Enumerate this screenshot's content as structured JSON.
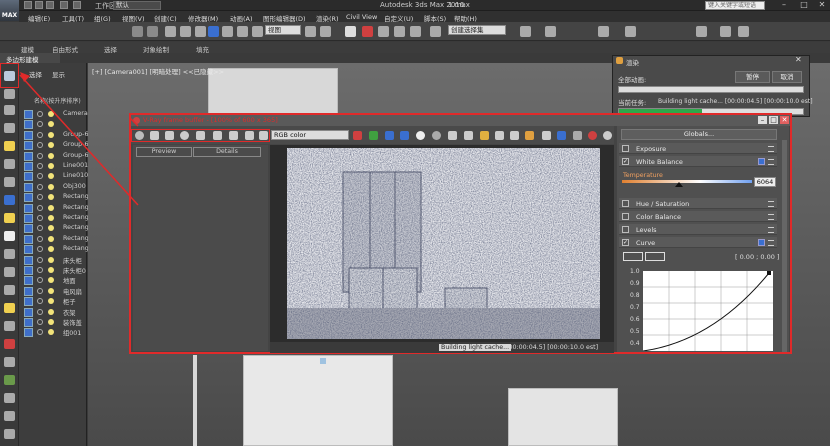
{
  "titlebar": {
    "logo": "MAX",
    "workspace_label": "工作区:",
    "workspace_value": "默认",
    "app_title": "Autodesk 3ds Max 2016",
    "file_name": "1.max",
    "search_placeholder": "键入关键字或短语"
  },
  "menubar": {
    "items": [
      "编辑(E)",
      "工具(T)",
      "组(G)",
      "视图(V)",
      "创建(C)",
      "修改器(M)",
      "动画(A)",
      "图形编辑器(D)",
      "渲染(R)",
      "Civil View",
      "自定义(U)",
      "脚本(S)",
      "帮助(H)"
    ]
  },
  "toolbar": {
    "view_dropdown": "视图",
    "selection_set_dropdown": "创建选择集"
  },
  "ribbon": {
    "tabs": [
      "建模",
      "自由形式",
      "选择",
      "对象绘制",
      "填充"
    ],
    "sub_label": "多边形建模"
  },
  "explorer": {
    "tabs": [
      "选择",
      "显示"
    ],
    "header": "名称(按升序排序)",
    "items": [
      "Camera",
      "",
      "Group-6",
      "Group-6",
      "Group-6",
      "Line001",
      "Line010",
      "Obj300",
      "Rectang",
      "Rectang",
      "Rectang",
      "Rectang",
      "Rectang",
      "Rectang",
      "床头柜",
      "床头柜0",
      "地面",
      "电风扇",
      "柜子",
      "衣架",
      "装饰盖",
      "组001"
    ]
  },
  "viewport": {
    "label": "[+] [Camera001] [明暗处理] <<已隐藏>>"
  },
  "render_dialog": {
    "title": "渲染",
    "all_label": "全部动画:",
    "pause_label": "暂停",
    "cancel_label": "取消",
    "current_task_label": "当前任务:",
    "current_task_text": "Building light cache... [00:00:04.5] [00:00:10.0 est]",
    "progress_fraction": 0.45
  },
  "vfb": {
    "title": "V-Ray frame buffer - [100% of 600 x 365]",
    "channel": "RGB color",
    "tabs": [
      "Preview",
      "Details"
    ],
    "status_text": "Building light cache...",
    "status_time": "[00:00:04.5] [00:00:10.0 est]"
  },
  "color_correction": {
    "globals_label": "Globals...",
    "rows": [
      {
        "label": "Exposure",
        "checked": false
      },
      {
        "label": "White Balance",
        "checked": true
      },
      {
        "label": "Hue / Saturation",
        "checked": false
      },
      {
        "label": "Color Balance",
        "checked": false
      },
      {
        "label": "Levels",
        "checked": false
      },
      {
        "label": "Curve",
        "checked": true
      }
    ],
    "temperature_label": "Temperature",
    "temperature_value": "6064",
    "curve_coords": "[ 0.00 ; 0.00 ]",
    "curve_ticks": [
      "1.0",
      "0.9",
      "0.8",
      "0.7",
      "0.6",
      "0.5",
      "0.4"
    ]
  },
  "colors": {
    "annotation_red": "#e02a2a",
    "progress_green": "#2ea84a",
    "accent_blue": "#3a6fd0"
  }
}
